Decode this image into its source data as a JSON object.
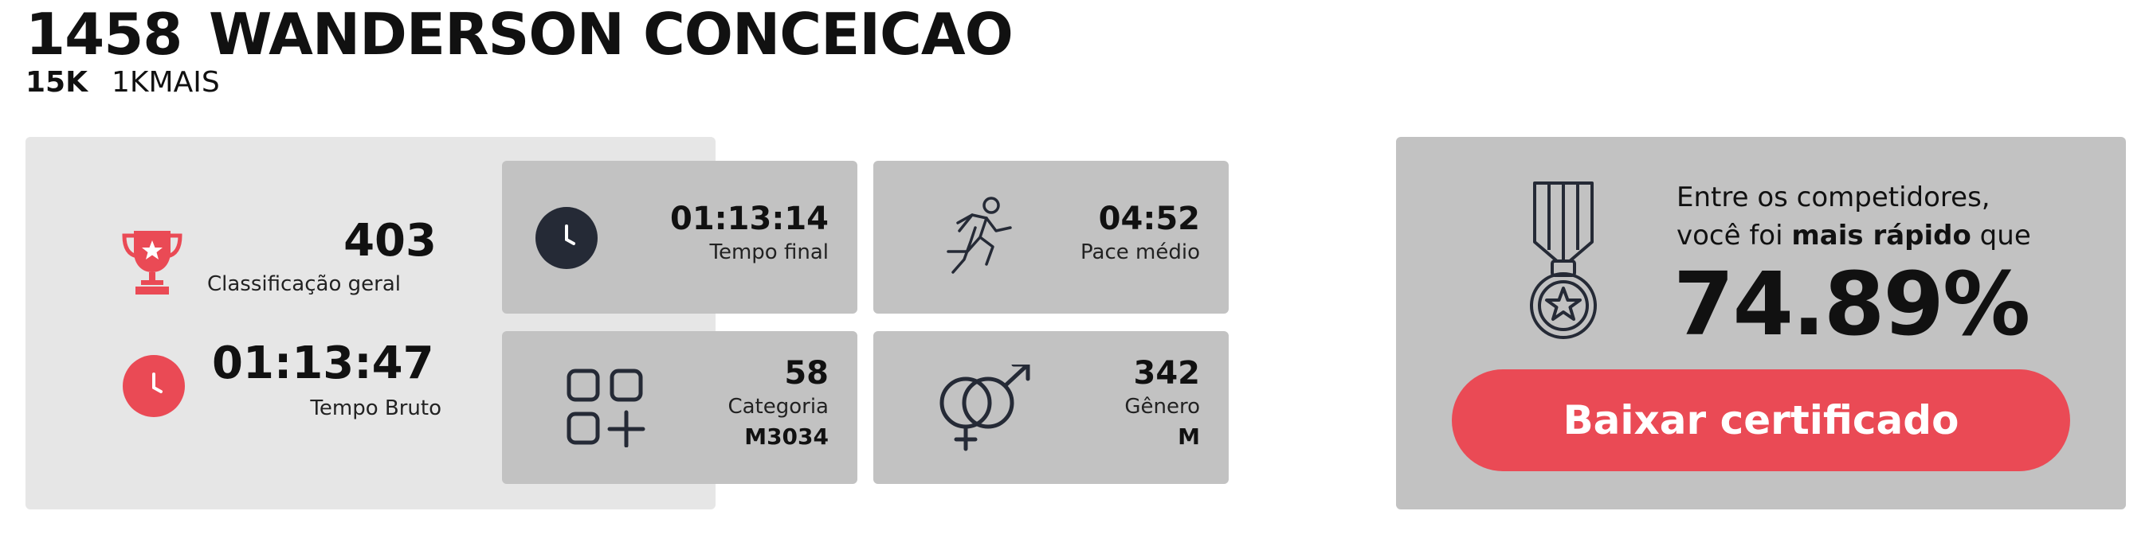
{
  "header": {
    "bib": "1458",
    "name": "WANDERSON CONCEICAO",
    "distance": "15K",
    "event": "1KMAIS"
  },
  "stats": {
    "classificacao": {
      "value": "403",
      "label": "Classificação geral",
      "icon": "trophy-icon"
    },
    "tempo_bruto": {
      "value": "01:13:47",
      "label": "Tempo Bruto",
      "icon": "clock-icon"
    },
    "tempo_final": {
      "value": "01:13:14",
      "label": "Tempo final",
      "icon": "clock-icon"
    },
    "pace": {
      "value": "04:52",
      "label": "Pace médio",
      "icon": "runner-icon"
    },
    "categoria": {
      "value": "58",
      "label": "Categoria",
      "sub": "M3034",
      "icon": "category-grid-icon"
    },
    "genero": {
      "value": "342",
      "label": "Gênero",
      "sub": "M",
      "icon": "gender-icon"
    }
  },
  "summary": {
    "line1": "Entre os competidores,",
    "line2_pre": "você foi ",
    "line2_bold": "mais rápido",
    "line2_post": " que",
    "percent": "74.89%",
    "icon": "medal-icon"
  },
  "actions": {
    "download_label": "Baixar certificado"
  },
  "colors": {
    "accent": "#ea4a55",
    "card": "#c2c2c2",
    "panel": "#e6e6e6",
    "dark_icon": "#252a36"
  }
}
